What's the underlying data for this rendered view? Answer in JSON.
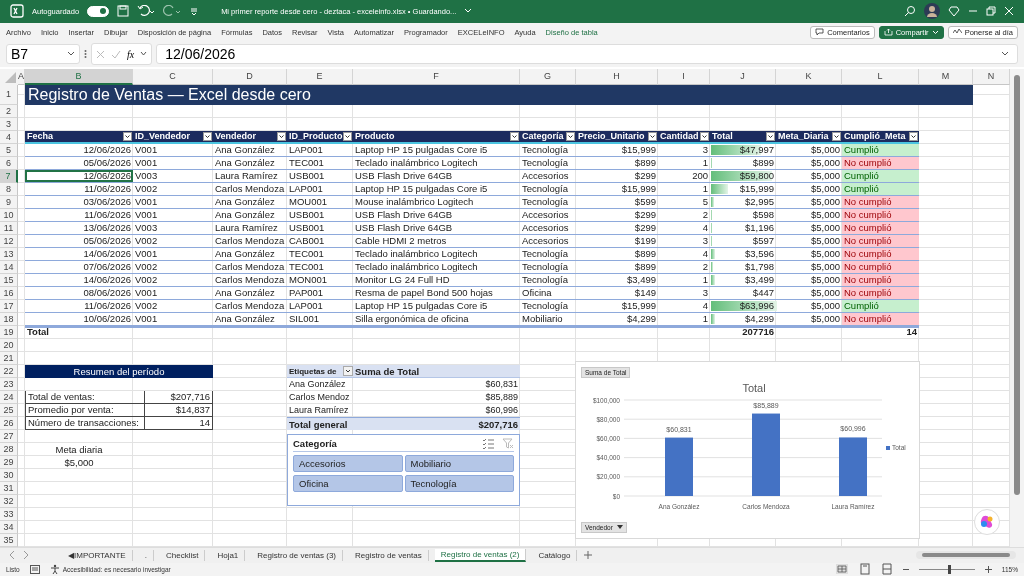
{
  "window": {
    "title": "Mi primer reporte desde cero - deztaca - exceleinfo.xlsx • Guardando...",
    "autosave": {
      "label": "Autoguardado",
      "on": true
    }
  },
  "ribbon_tabs": [
    {
      "label": "Archivo",
      "kind": "standard"
    },
    {
      "label": "Inicio",
      "kind": "standard"
    },
    {
      "label": "Insertar",
      "kind": "standard"
    },
    {
      "label": "Dibujar",
      "kind": "standard"
    },
    {
      "label": "Disposición de página",
      "kind": "standard"
    },
    {
      "label": "Fórmulas",
      "kind": "standard"
    },
    {
      "label": "Datos",
      "kind": "standard"
    },
    {
      "label": "Revisar",
      "kind": "standard"
    },
    {
      "label": "Vista",
      "kind": "standard"
    },
    {
      "label": "Automatizar",
      "kind": "standard"
    },
    {
      "label": "Programador",
      "kind": "standard"
    },
    {
      "label": "EXCELeINFO",
      "kind": "standard"
    },
    {
      "label": "Ayuda",
      "kind": "standard"
    },
    {
      "label": "Diseño de tabla",
      "kind": "contextual"
    }
  ],
  "ribbon_buttons": [
    {
      "label": "Comentarios",
      "kind": "comment"
    },
    {
      "label": "Compartir",
      "kind": "share"
    },
    {
      "label": "Ponerse al día",
      "kind": "catchup"
    }
  ],
  "formula_bar": {
    "name_box": "B7",
    "function_label": "fx",
    "formula": "12/06/2026"
  },
  "columns": [
    {
      "label": "A",
      "selected": false
    },
    {
      "label": "B",
      "selected": true
    },
    {
      "label": "C",
      "selected": false
    },
    {
      "label": "D",
      "selected": false
    },
    {
      "label": "E",
      "selected": false
    },
    {
      "label": "F",
      "selected": false
    },
    {
      "label": "G",
      "selected": false
    },
    {
      "label": "H",
      "selected": false
    },
    {
      "label": "I",
      "selected": false
    },
    {
      "label": "J",
      "selected": false
    },
    {
      "label": "K",
      "selected": false
    },
    {
      "label": "L",
      "selected": false
    },
    {
      "label": "M",
      "selected": false
    },
    {
      "label": "N",
      "selected": false
    }
  ],
  "row_headers": [
    {
      "label": "1",
      "selected": false
    },
    {
      "label": "2",
      "selected": false
    },
    {
      "label": "3",
      "selected": false
    },
    {
      "label": "4",
      "selected": false
    },
    {
      "label": "5",
      "selected": false
    },
    {
      "label": "6",
      "selected": false
    },
    {
      "label": "7",
      "selected": true
    },
    {
      "label": "8",
      "selected": false
    },
    {
      "label": "9",
      "selected": false
    },
    {
      "label": "10",
      "selected": false
    },
    {
      "label": "11",
      "selected": false
    },
    {
      "label": "12",
      "selected": false
    },
    {
      "label": "13",
      "selected": false
    },
    {
      "label": "14",
      "selected": false
    },
    {
      "label": "15",
      "selected": false
    },
    {
      "label": "16",
      "selected": false
    },
    {
      "label": "17",
      "selected": false
    },
    {
      "label": "18",
      "selected": false
    },
    {
      "label": "19",
      "selected": false
    },
    {
      "label": "20",
      "selected": false
    },
    {
      "label": "21",
      "selected": false
    },
    {
      "label": "22",
      "selected": false
    },
    {
      "label": "23",
      "selected": false
    },
    {
      "label": "24",
      "selected": false
    },
    {
      "label": "25",
      "selected": false
    },
    {
      "label": "26",
      "selected": false
    },
    {
      "label": "27",
      "selected": false
    },
    {
      "label": "28",
      "selected": false
    },
    {
      "label": "29",
      "selected": false
    },
    {
      "label": "30",
      "selected": false
    },
    {
      "label": "31",
      "selected": false
    },
    {
      "label": "32",
      "selected": false
    },
    {
      "label": "33",
      "selected": false
    },
    {
      "label": "34",
      "selected": false
    },
    {
      "label": "35",
      "selected": false
    }
  ],
  "sheet_title": "Registro de Ventas — Excel desde cero",
  "table": {
    "columns": [
      "Fecha",
      "ID_Vendedor",
      "Vendedor",
      "ID_Producto",
      "Producto",
      "Categoría",
      "Precio_Unitario",
      "Cantidad",
      "Total",
      "Meta_Diaria",
      "Cumplió_Meta"
    ],
    "rows": [
      {
        "fecha": "12/06/2026",
        "id_vendedor": "V001",
        "vendedor": "Ana González",
        "id_producto": "LAP001",
        "producto": "Laptop HP 15 pulgadas Core i5",
        "categoria": "Tecnología",
        "precio": "$15,999",
        "cantidad": "3",
        "total": "$47,997",
        "level": 0.75,
        "meta": "$5,000",
        "cumplio": "Cumplió",
        "met": true,
        "active": false
      },
      {
        "fecha": "05/06/2026",
        "id_vendedor": "V001",
        "vendedor": "Ana González",
        "id_producto": "TEC001",
        "producto": "Teclado inalámbrico Logitech",
        "categoria": "Tecnología",
        "precio": "$899",
        "cantidad": "1",
        "total": "$899",
        "level": 0.014,
        "meta": "$5,000",
        "cumplio": "No cumplió",
        "met": false,
        "active": false
      },
      {
        "fecha": "12/06/2026",
        "id_vendedor": "V003",
        "vendedor": "Laura Ramírez",
        "id_producto": "USB001",
        "producto": "USB Flash Drive 64GB",
        "categoria": "Accesorios",
        "precio": "$299",
        "cantidad": "200",
        "total": "$59,800",
        "level": 0.93,
        "meta": "$5,000",
        "cumplio": "Cumplió",
        "met": true,
        "active": true
      },
      {
        "fecha": "11/06/2026",
        "id_vendedor": "V002",
        "vendedor": "Carlos Mendoza",
        "id_producto": "LAP001",
        "producto": "Laptop HP 15 pulgadas Core i5",
        "categoria": "Tecnología",
        "precio": "$15,999",
        "cantidad": "1",
        "total": "$15,999",
        "level": 0.25,
        "meta": "$5,000",
        "cumplio": "Cumplió",
        "met": true,
        "active": false
      },
      {
        "fecha": "03/06/2026",
        "id_vendedor": "V001",
        "vendedor": "Ana González",
        "id_producto": "MOU001",
        "producto": "Mouse inalámbrico Logitech",
        "categoria": "Tecnología",
        "precio": "$599",
        "cantidad": "5",
        "total": "$2,995",
        "level": 0.047,
        "meta": "$5,000",
        "cumplio": "No cumplió",
        "met": false,
        "active": false
      },
      {
        "fecha": "11/06/2026",
        "id_vendedor": "V001",
        "vendedor": "Ana González",
        "id_producto": "USB001",
        "producto": "USB Flash Drive 64GB",
        "categoria": "Accesorios",
        "precio": "$299",
        "cantidad": "2",
        "total": "$598",
        "level": 0.009,
        "meta": "$5,000",
        "cumplio": "No cumplió",
        "met": false,
        "active": false
      },
      {
        "fecha": "13/06/2026",
        "id_vendedor": "V003",
        "vendedor": "Laura Ramírez",
        "id_producto": "USB001",
        "producto": "USB Flash Drive 64GB",
        "categoria": "Accesorios",
        "precio": "$299",
        "cantidad": "4",
        "total": "$1,196",
        "level": 0.019,
        "meta": "$5,000",
        "cumplio": "No cumplió",
        "met": false,
        "active": false
      },
      {
        "fecha": "05/06/2026",
        "id_vendedor": "V002",
        "vendedor": "Carlos Mendoza",
        "id_producto": "CAB001",
        "producto": "Cable HDMI 2 metros",
        "categoria": "Accesorios",
        "precio": "$199",
        "cantidad": "3",
        "total": "$597",
        "level": 0.009,
        "meta": "$5,000",
        "cumplio": "No cumplió",
        "met": false,
        "active": false
      },
      {
        "fecha": "14/06/2026",
        "id_vendedor": "V001",
        "vendedor": "Ana González",
        "id_producto": "TEC001",
        "producto": "Teclado inalámbrico Logitech",
        "categoria": "Tecnología",
        "precio": "$899",
        "cantidad": "4",
        "total": "$3,596",
        "level": 0.056,
        "meta": "$5,000",
        "cumplio": "No cumplió",
        "met": false,
        "active": false
      },
      {
        "fecha": "07/06/2026",
        "id_vendedor": "V002",
        "vendedor": "Carlos Mendoza",
        "id_producto": "TEC001",
        "producto": "Teclado inalámbrico Logitech",
        "categoria": "Tecnología",
        "precio": "$899",
        "cantidad": "2",
        "total": "$1,798",
        "level": 0.028,
        "meta": "$5,000",
        "cumplio": "No cumplió",
        "met": false,
        "active": false
      },
      {
        "fecha": "14/06/2026",
        "id_vendedor": "V002",
        "vendedor": "Carlos Mendoza",
        "id_producto": "MON001",
        "producto": "Monitor LG 24 Full HD",
        "categoria": "Tecnología",
        "precio": "$3,499",
        "cantidad": "1",
        "total": "$3,499",
        "level": 0.055,
        "meta": "$5,000",
        "cumplio": "No cumplió",
        "met": false,
        "active": false
      },
      {
        "fecha": "08/06/2026",
        "id_vendedor": "V001",
        "vendedor": "Ana González",
        "id_producto": "PAP001",
        "producto": "Resma de papel Bond 500 hojas",
        "categoria": "Oficina",
        "precio": "$149",
        "cantidad": "3",
        "total": "$447",
        "level": 0.007,
        "meta": "$5,000",
        "cumplio": "No cumplió",
        "met": false,
        "active": false
      },
      {
        "fecha": "11/06/2026",
        "id_vendedor": "V002",
        "vendedor": "Carlos Mendoza",
        "id_producto": "LAP001",
        "producto": "Laptop HP 15 pulgadas Core i5",
        "categoria": "Tecnología",
        "precio": "$15,999",
        "cantidad": "4",
        "total": "$63,996",
        "level": 1,
        "meta": "$5,000",
        "cumplio": "Cumplió",
        "met": true,
        "active": false
      },
      {
        "fecha": "10/06/2026",
        "id_vendedor": "V001",
        "vendedor": "Ana González",
        "id_producto": "SIL001",
        "producto": "Silla ergonómica de oficina",
        "categoria": "Mobiliario",
        "precio": "$4,299",
        "cantidad": "1",
        "total": "$4,299",
        "level": 0.067,
        "meta": "$5,000",
        "cumplio": "No cumplió",
        "met": false,
        "active": false
      }
    ],
    "total_row": {
      "label": "Total",
      "total": "207716",
      "count": "14"
    }
  },
  "summary": {
    "title": "Resumen del período",
    "rows": [
      {
        "label": "Total de ventas:",
        "value": "$207,716"
      },
      {
        "label": "Promedio por venta:",
        "value": "$14,837"
      },
      {
        "label": "Número de transacciones:",
        "value": "14"
      }
    ],
    "meta_label": "Meta diaria",
    "meta_value": "$5,000"
  },
  "pivot": {
    "row_label": "Etiquetas de",
    "value_label": "Suma de Total",
    "rows": [
      {
        "label": "Ana González",
        "value": "$60,831"
      },
      {
        "label": "Carlos Mendoz",
        "value": "$85,889"
      },
      {
        "label": "Laura Ramírez",
        "value": "$60,996"
      }
    ],
    "total_label": "Total general",
    "total_value": "$207,716"
  },
  "slicer": {
    "title": "Categoría",
    "items": [
      {
        "label": "Accesorios",
        "selected": true
      },
      {
        "label": "Mobiliario",
        "selected": true
      },
      {
        "label": "Oficina",
        "selected": true
      },
      {
        "label": "Tecnología",
        "selected": true
      }
    ]
  },
  "chart": {
    "value_button": "Suma de Total",
    "axis_button": "Vendedor",
    "chart_data": {
      "type": "bar",
      "title": "Total",
      "categories": [
        "Ana González",
        "Carlos Mendoza",
        "Laura Ramírez"
      ],
      "series": [
        {
          "name": "Total",
          "color": "#4472c4",
          "values": [
            60831,
            85889,
            60996
          ]
        }
      ],
      "ylim": [
        0,
        100000
      ],
      "grid": true,
      "yticks": [
        {
          "value": 0,
          "label": "$0"
        },
        {
          "value": 20000,
          "label": "$20,000"
        },
        {
          "value": 40000,
          "label": "$40,000"
        },
        {
          "value": 60000,
          "label": "$60,000"
        },
        {
          "value": 80000,
          "label": "$80,000"
        },
        {
          "value": 100000,
          "label": "$100,000"
        }
      ],
      "value_labels": [
        "$60,831",
        "$85,889",
        "$60,996"
      ]
    }
  },
  "sheet_tabs": [
    {
      "label": "◀IMPORTANTE",
      "selected": false
    },
    {
      "label": ".",
      "selected": false
    },
    {
      "label": "Checklist",
      "selected": false
    },
    {
      "label": "Hoja1",
      "selected": false
    },
    {
      "label": "Registro de ventas (3)",
      "selected": false
    },
    {
      "label": "Registro de ventas",
      "selected": false
    },
    {
      "label": "Registro de ventas (2)",
      "selected": true
    },
    {
      "label": "Catálogo",
      "selected": false
    }
  ],
  "status_bar": {
    "state": "Listo",
    "accessibility": "Accesibilidad: es necesario investigar",
    "zoom": "115%",
    "zoom_level": {
      "level": 0.54
    }
  }
}
